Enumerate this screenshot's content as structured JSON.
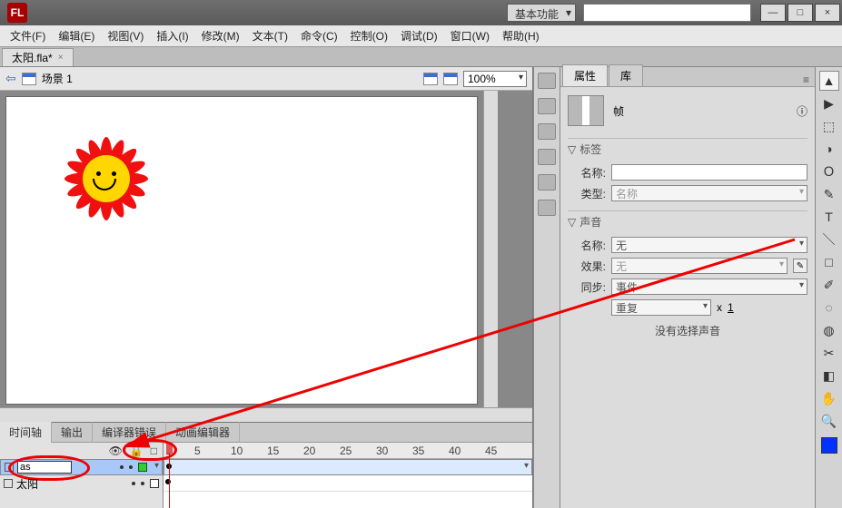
{
  "titlebar": {
    "logo": "FL",
    "workspace": "基本功能",
    "search_placeholder": ""
  },
  "window_buttons": {
    "min": "—",
    "max": "□",
    "close": "×"
  },
  "menu": [
    "文件(F)",
    "编辑(E)",
    "视图(V)",
    "插入(I)",
    "修改(M)",
    "文本(T)",
    "命令(C)",
    "控制(O)",
    "调试(D)",
    "窗口(W)",
    "帮助(H)"
  ],
  "doc_tab": {
    "label": "太阳.fla*",
    "close": "×"
  },
  "stage": {
    "back": "⇦",
    "scene": "场景 1",
    "zoom": "100%"
  },
  "timeline": {
    "tabs": [
      "时间轴",
      "输出",
      "编译器错误",
      "动画编辑器"
    ],
    "hdr_icons": [
      "👁",
      "🔒",
      "□"
    ],
    "ruler": [
      1,
      5,
      10,
      15,
      20,
      25,
      30,
      35,
      40,
      45
    ],
    "layers": [
      {
        "name_editing": "as",
        "selected": true
      },
      {
        "name": "太阳",
        "selected": false
      }
    ]
  },
  "panel": {
    "tabs": [
      "属性",
      "库"
    ],
    "frame_label": "帧",
    "sections": {
      "label": {
        "title": "标签",
        "name_label": "名称:",
        "type_label": "类型:",
        "type_value": "名称"
      },
      "sound": {
        "title": "声音",
        "name_label": "名称:",
        "name_value": "无",
        "effect_label": "效果:",
        "effect_value": "无",
        "sync_label": "同步:",
        "sync_value": "事件",
        "repeat_value": "重复",
        "repeat_x": "x",
        "repeat_n": "1",
        "note": "没有选择声音"
      }
    }
  },
  "tools": [
    "▲",
    "▶",
    "⬚",
    "◑",
    "Ｏ",
    "✎",
    "T",
    "＼",
    "□",
    "✐",
    "◌",
    "◍",
    "✂",
    "◧",
    "✋",
    "🔍"
  ]
}
